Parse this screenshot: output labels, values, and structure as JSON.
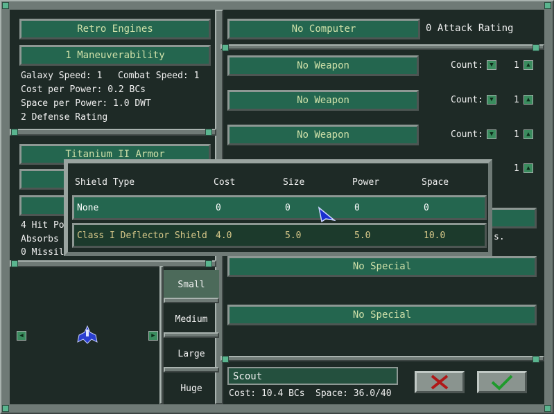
{
  "left": {
    "engine_button": "Retro Engines",
    "maneuver_button": "1 Maneuverability",
    "galaxy_speed": "Galaxy Speed: 1",
    "combat_speed": "Combat Speed: 1",
    "cost_per_power": "Cost per Power: 0.2 BCs",
    "space_per_power": "Space per Power: 1.0 DWT",
    "defense_rating": "2 Defense Rating",
    "armor_button": "Titanium II Armor",
    "hit_points_partial": "4 Hit Poi",
    "absorbs_partial": "Absorbs",
    "missile_partial": "0 Missile"
  },
  "right": {
    "computer_button": "No Computer",
    "attack_rating": "0 Attack Rating",
    "weapons": [
      {
        "label": "No Weapon",
        "count_label": "Count:",
        "count": "1"
      },
      {
        "label": "No Weapon",
        "count_label": "Count:",
        "count": "1"
      },
      {
        "label": "No Weapon",
        "count_label": "Count:",
        "count": "1"
      }
    ],
    "hidden_count": "1",
    "hidden_suffix": "s.",
    "specials": [
      "No Special",
      "No Special"
    ]
  },
  "shield_popup": {
    "headers": [
      "Shield Type",
      "Cost",
      "Size",
      "Power",
      "Space"
    ],
    "rows": [
      {
        "type": "None",
        "cost": "0",
        "size": "0",
        "power": "0",
        "space": "0"
      },
      {
        "type": "Class I Deflector Shield",
        "cost": "4.0",
        "size": "5.0",
        "power": "5.0",
        "space": "10.0"
      }
    ]
  },
  "sizes": [
    "Small",
    "Medium",
    "Large",
    "Huge"
  ],
  "selected_size": "Small",
  "ship": {
    "name": "Scout",
    "cost": "Cost: 10.4 BCs",
    "space": "Space: 36.0/40"
  },
  "colors": {
    "background": "#1e2a26",
    "button": "#24664f",
    "frame": "#6f7a76",
    "cancel_mark": "#b01818",
    "ok_mark": "#1f9a2c"
  },
  "icons": {
    "arrow_down": "down-arrow-icon",
    "arrow_up": "up-arrow-icon",
    "arrow_left": "left-arrow-icon",
    "arrow_right": "right-arrow-icon",
    "cancel": "x-icon",
    "ok": "check-icon",
    "cursor": "cursor-icon",
    "ship": "ship-icon"
  }
}
